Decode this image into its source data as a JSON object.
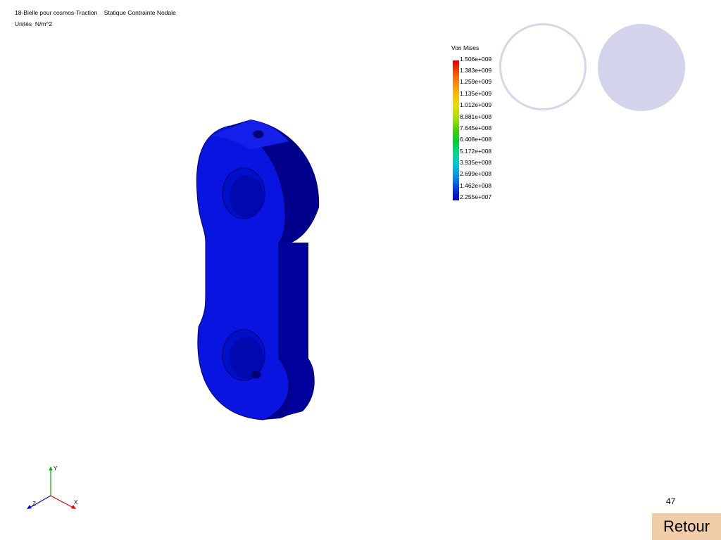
{
  "header": {
    "line1": "18-Bielle pour cosmos-Traction    Statique Contrainte Nodale",
    "line2": "Unités  N/m^2"
  },
  "legend": {
    "title": "Von Mises",
    "labels": [
      "1.506e+009",
      "1.383e+009",
      "1.259e+009",
      "1.135e+009",
      "1.012e+009",
      "8.881e+008",
      "7.645e+008",
      "6.408e+008",
      "5.172e+008",
      "3.935e+008",
      "2.699e+008",
      "1.462e+008",
      "2.255e+007"
    ]
  },
  "triad": {
    "x": "X",
    "y": "Y",
    "z": "Z"
  },
  "page_number": "47",
  "back_button_label": "Retour",
  "colors": {
    "model_blue": "#0a14e0",
    "button_bg": "#f2cdaa",
    "circle": "#d3d3eb"
  }
}
